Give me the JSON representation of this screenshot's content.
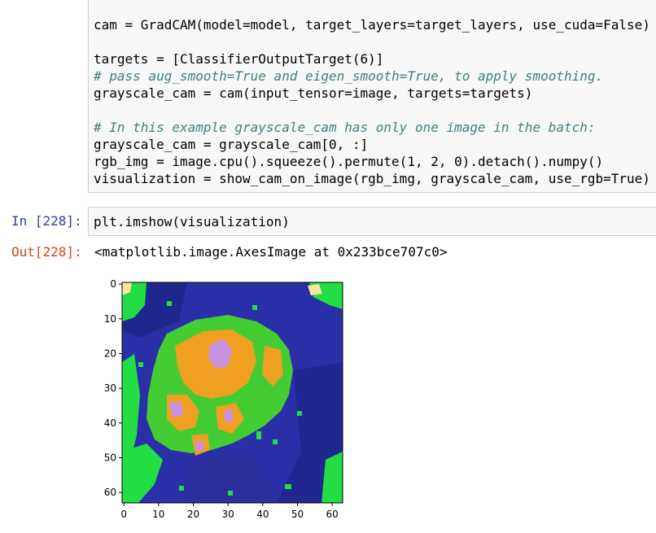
{
  "cell_top": {
    "lines": [
      "cam = GradCAM(model=model, target_layers=target_layers, use_cuda=False)",
      "",
      "targets = [ClassifierOutputTarget(6)]",
      "# pass aug_smooth=True and eigen_smooth=True, to apply smoothing.",
      "grayscale_cam = cam(input_tensor=image, targets=targets)",
      "",
      "# In this example grayscale_cam has only one image in the batch:",
      "grayscale_cam = grayscale_cam[0, :]",
      "rgb_img = image.cpu().squeeze().permute(1, 2, 0).detach().numpy()",
      "visualization = show_cam_on_image(rgb_img, grayscale_cam, use_rgb=True)"
    ]
  },
  "cell_in": {
    "prompt": "In [228]:",
    "code": "plt.imshow(visualization)"
  },
  "cell_out": {
    "prompt": "Out[228]:",
    "text": "<matplotlib.image.AxesImage at 0x233bce707c0>"
  },
  "plot": {
    "y_ticks": [
      "0",
      "10",
      "20",
      "30",
      "40",
      "50",
      "60"
    ],
    "x_ticks": [
      "0",
      "10",
      "20",
      "30",
      "40",
      "50",
      "60"
    ],
    "colors": {
      "background": "#2a2fa8",
      "dark": "#1c2380",
      "green": "#22dd44",
      "mid_green": "#44cc33",
      "orange": "#f0a020",
      "violet": "#c890e0",
      "cream": "#f5e6a0"
    }
  }
}
